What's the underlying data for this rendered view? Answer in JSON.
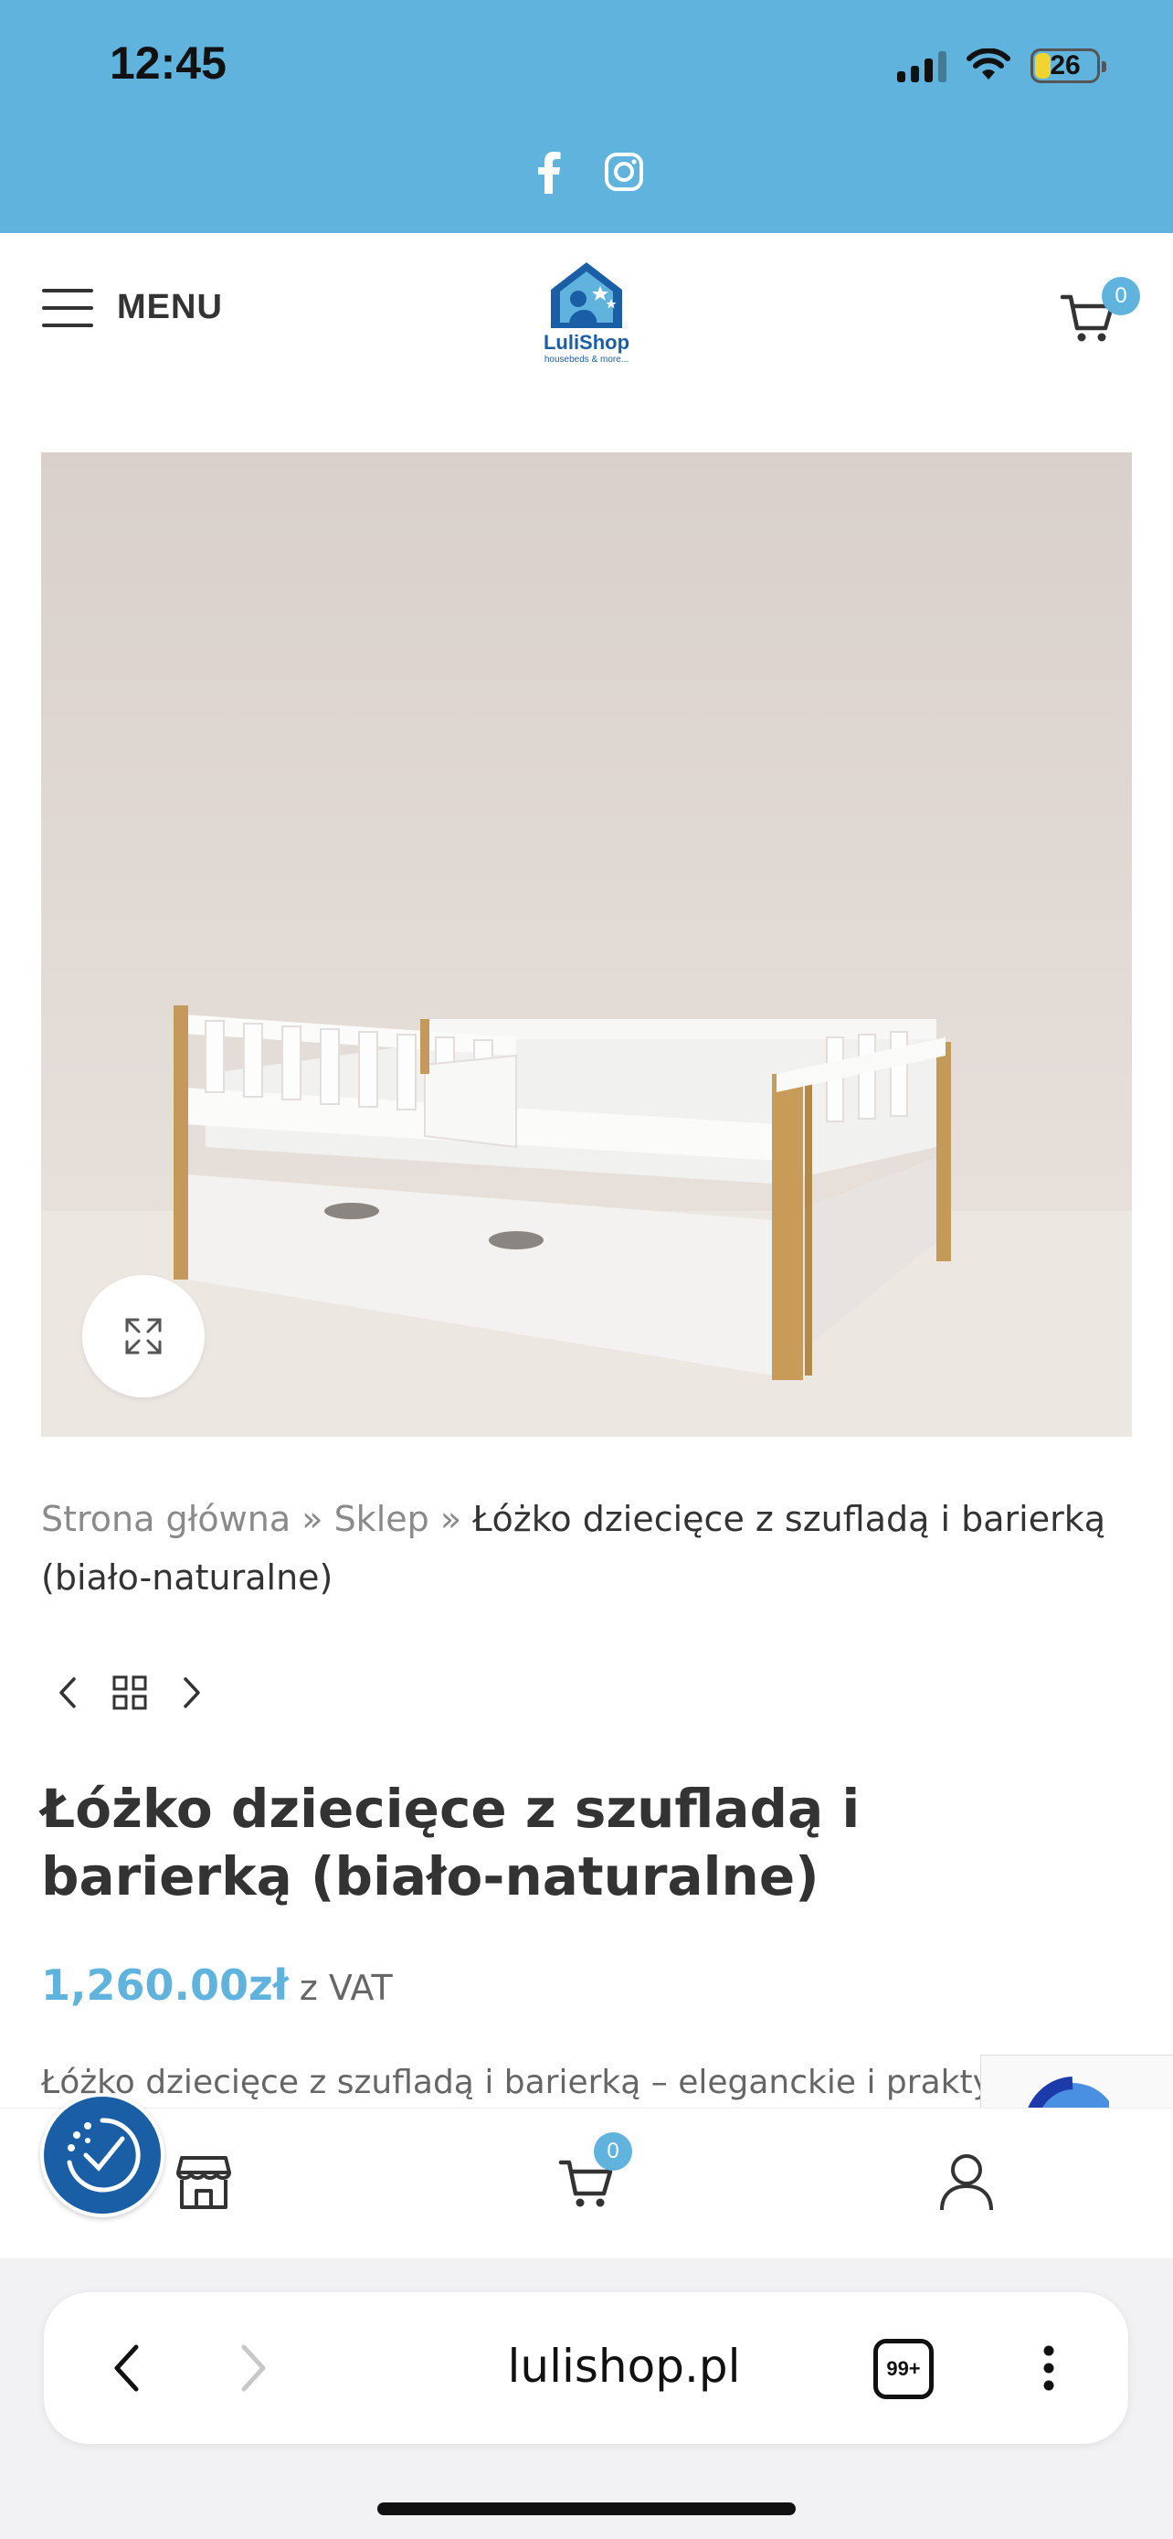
{
  "status_bar": {
    "time": "12:45",
    "battery": "26",
    "battery_level": 0.26
  },
  "social": {
    "icons": [
      "facebook-icon",
      "instagram-icon"
    ]
  },
  "header": {
    "menu_label": "MENU",
    "logo_text": "LuliShop",
    "logo_tagline": "housebeds & more...",
    "cart_count": "0"
  },
  "breadcrumb": {
    "home": "Strona główna",
    "separator": "»",
    "shop": "Sklep",
    "current": "Łóżko dziecięce z szufladą i barierką (biało-naturalne)"
  },
  "product": {
    "title": "Łóżko dziecięce z szufladą i barierką (biało-naturalne)",
    "price": "1,260.00zł",
    "price_suffix": "z VAT",
    "description": "Łóżko dziecięce z szufladą i barierką – eleganckie i praktyczne"
  },
  "toolbar": {
    "cart_count": "0",
    "icons": [
      "store-icon",
      "cart-icon",
      "user-icon",
      "accessibility-icon"
    ]
  },
  "browser": {
    "url": "lulishop.pl",
    "tabs_count": "99+"
  },
  "colors": {
    "accent": "#5fb3dc",
    "brand_blue": "#1a5fa6",
    "text": "#333333"
  }
}
